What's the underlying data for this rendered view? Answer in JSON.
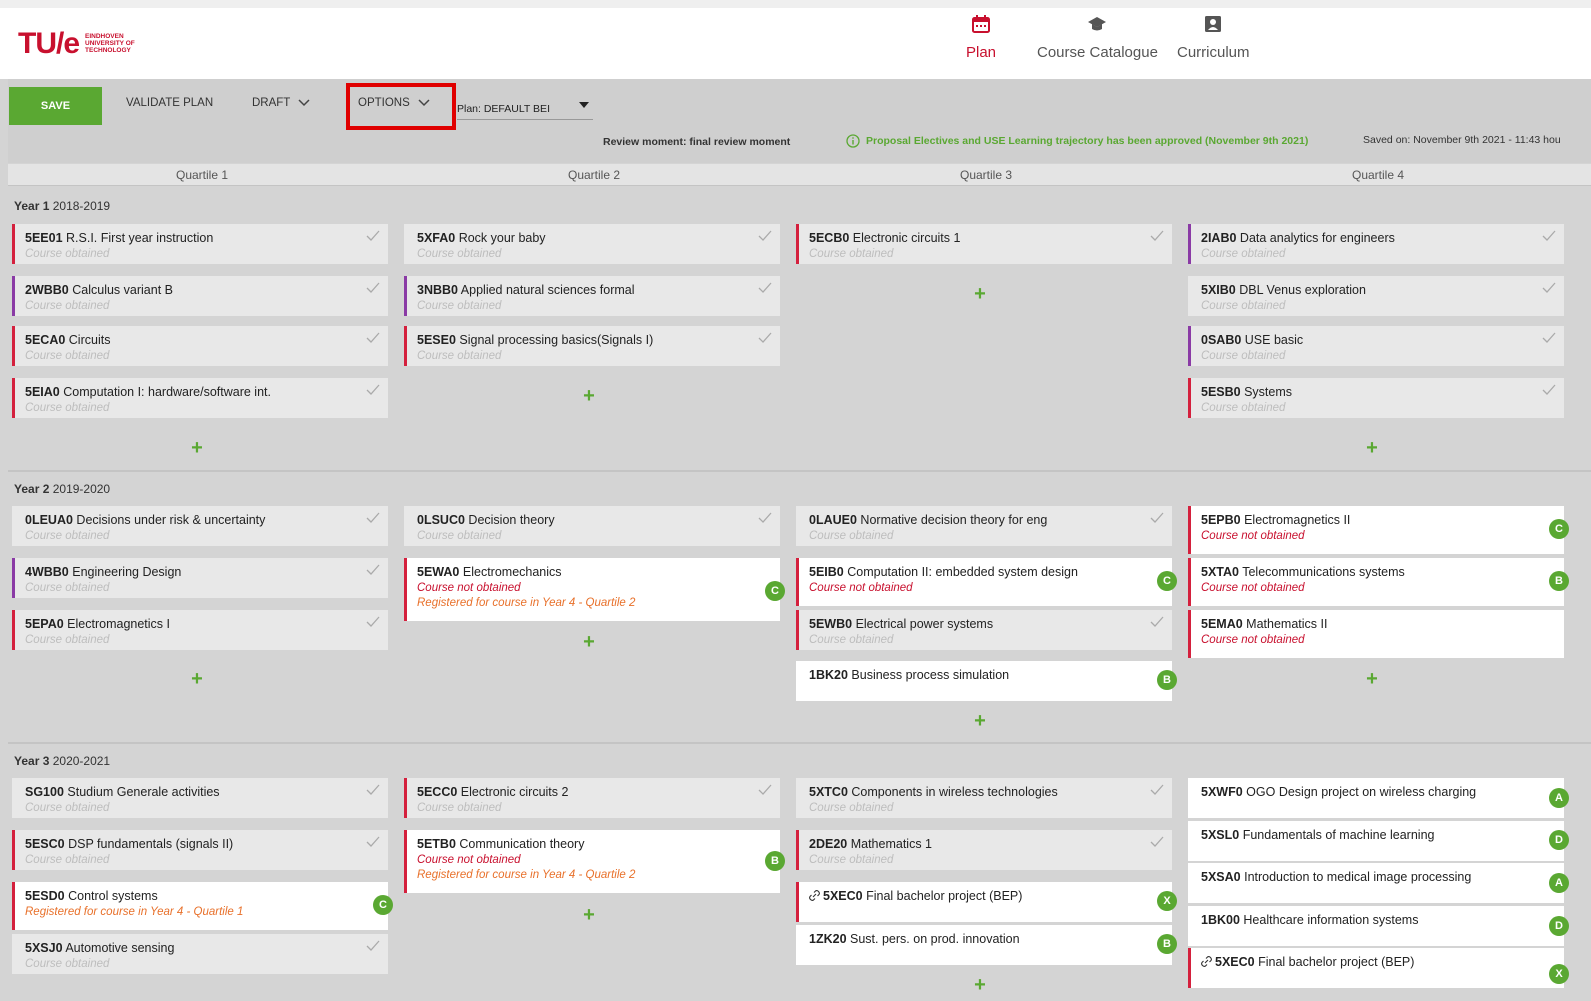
{
  "header": {
    "logo_mark": "TU/e",
    "logo_text_1": "EINDHOVEN",
    "logo_text_2": "UNIVERSITY OF",
    "logo_text_3": "TECHNOLOGY",
    "nav": [
      {
        "label": "Plan",
        "icon": "calendar-icon",
        "active": true
      },
      {
        "label": "Course Catalogue",
        "icon": "graduation-cap-icon"
      },
      {
        "label": "Curriculum",
        "icon": "id-card-icon"
      }
    ]
  },
  "toolbar": {
    "save": "SAVE",
    "validate": "VALIDATE PLAN",
    "draft": "DRAFT",
    "options": "OPTIONS",
    "plan_select": "Plan: DEFAULT BEI",
    "review": "Review moment: final review moment",
    "approved": "Proposal Electives and USE Learning trajectory has been approved (November 9th 2021)",
    "saved": "Saved on: November 9th 2021 - 11:43 hou"
  },
  "quartiles": [
    "Quartile 1",
    "Quartile 2",
    "Quartile 3",
    "Quartile 4"
  ],
  "years": [
    {
      "label": "Year 1",
      "range": "2018-2019"
    },
    {
      "label": "Year 2",
      "range": "2019-2020"
    },
    {
      "label": "Year 3",
      "range": "2020-2021"
    }
  ],
  "status": {
    "obtained": "Course obtained",
    "not_obtained": "Course not obtained"
  },
  "courses": {
    "y1q1": [
      {
        "code": "5EE01",
        "name": "R.S.I. First year instruction"
      },
      {
        "code": "2WBB0",
        "name": "Calculus variant B"
      },
      {
        "code": "5ECA0",
        "name": "Circuits"
      },
      {
        "code": "5EIA0",
        "name": "Computation I: hardware/software int."
      }
    ],
    "y1q2": [
      {
        "code": "5XFA0",
        "name": "Rock your baby"
      },
      {
        "code": "3NBB0",
        "name": "Applied natural sciences formal"
      },
      {
        "code": "5ESE0",
        "name": "Signal processing basics(Signals I)"
      }
    ],
    "y1q3": [
      {
        "code": "5ECB0",
        "name": "Electronic circuits 1"
      }
    ],
    "y1q4": [
      {
        "code": "2IAB0",
        "name": "Data analytics for engineers"
      },
      {
        "code": "5XIB0",
        "name": "DBL Venus exploration"
      },
      {
        "code": "0SAB0",
        "name": "USE basic"
      },
      {
        "code": "5ESB0",
        "name": "Systems"
      }
    ],
    "y2q1": [
      {
        "code": "0LEUA0",
        "name": "Decisions under risk & uncertainty"
      },
      {
        "code": "4WBB0",
        "name": "Engineering Design"
      },
      {
        "code": "5EPA0",
        "name": "Electromagnetics I"
      }
    ],
    "y2q2": [
      {
        "code": "0LSUC0",
        "name": "Decision theory"
      },
      {
        "code": "5EWA0",
        "name": "Electromechanics",
        "reg": "Registered for course in Year 4 - Quartile 2",
        "badge": "C"
      }
    ],
    "y2q3": [
      {
        "code": "0LAUE0",
        "name": "Normative decision theory for eng"
      },
      {
        "code": "5EIB0",
        "name": "Computation II: embedded system design",
        "badge": "C"
      },
      {
        "code": "5EWB0",
        "name": "Electrical power systems"
      },
      {
        "code": "1BK20",
        "name": "Business process simulation",
        "badge": "B"
      }
    ],
    "y2q4": [
      {
        "code": "5EPB0",
        "name": "Electromagnetics II",
        "badge": "C"
      },
      {
        "code": "5XTA0",
        "name": "Telecommunications systems",
        "badge": "B"
      },
      {
        "code": "5EMA0",
        "name": "Mathematics II"
      }
    ],
    "y3q1": [
      {
        "code": "SG100",
        "name": "Studium Generale activities"
      },
      {
        "code": "5ESC0",
        "name": "DSP fundamentals (signals II)"
      },
      {
        "code": "5ESD0",
        "name": "Control systems",
        "reg": "Registered for course in Year 4 - Quartile 1",
        "badge": "C"
      },
      {
        "code": "5XSJ0",
        "name": "Automotive sensing"
      }
    ],
    "y3q2": [
      {
        "code": "5ECC0",
        "name": "Electronic circuits 2"
      },
      {
        "code": "5ETB0",
        "name": "Communication theory",
        "reg": "Registered for course in Year 4 - Quartile 2",
        "badge": "B"
      }
    ],
    "y3q3": [
      {
        "code": "5XTC0",
        "name": "Components in wireless technologies"
      },
      {
        "code": "2DE20",
        "name": "Mathematics 1"
      },
      {
        "code": "5XEC0",
        "name": "Final bachelor project (BEP)",
        "badge": "X"
      },
      {
        "code": "1ZK20",
        "name": "Sust. pers. on prod. innovation",
        "badge": "B"
      }
    ],
    "y3q4": [
      {
        "code": "5XWF0",
        "name": "OGO Design project on wireless charging",
        "badge": "A"
      },
      {
        "code": "5XSL0",
        "name": "Fundamentals of machine learning",
        "badge": "D"
      },
      {
        "code": "5XSA0",
        "name": "Introduction to medical image processing",
        "badge": "A"
      },
      {
        "code": "1BK00",
        "name": "Healthcare information systems",
        "badge": "D"
      },
      {
        "code": "5XEC0",
        "name": "Final bachelor project (BEP)",
        "badge": "X"
      }
    ]
  },
  "add_symbol": "+"
}
